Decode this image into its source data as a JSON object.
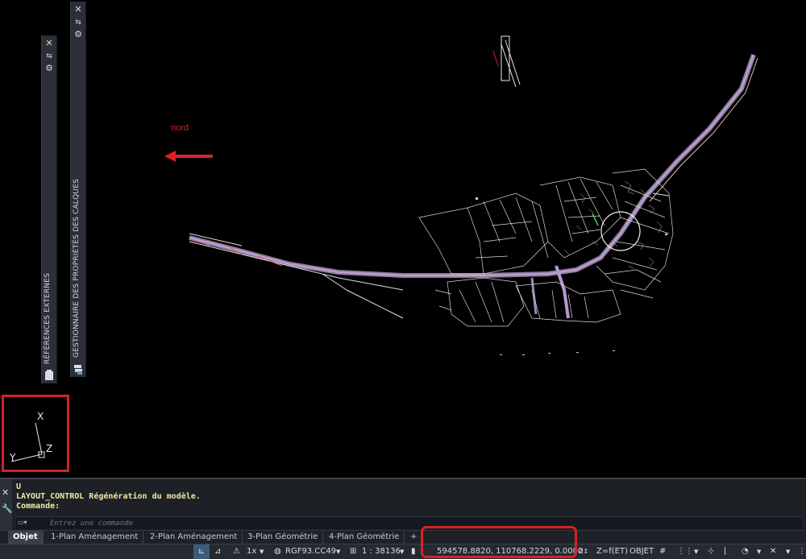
{
  "canvas": {
    "annotation_nord": "nord"
  },
  "palettes": {
    "external_refs": {
      "title": "RÉFÉRENCES EXTERNES"
    },
    "layer_props": {
      "title": "GESTIONNAIRE DES PROPRIÉTÉS DES CALQUES"
    }
  },
  "ucs": {
    "x": "X",
    "y": "Y",
    "z": "Z"
  },
  "command": {
    "lines": [
      "U",
      "LAYOUT_CONTROL Régénération du modèle.",
      "Commande:"
    ],
    "placeholder": "Entrez une commande"
  },
  "tabs": [
    {
      "label": "Objet",
      "active": true
    },
    {
      "label": "1-Plan Aménagement"
    },
    {
      "label": "2-Plan Aménagement"
    },
    {
      "label": "3-Plan Géométrie"
    },
    {
      "label": "4-Plan Géométrie"
    },
    {
      "label": "+"
    }
  ],
  "status": {
    "scale_factor": "1x",
    "coord_system": "RGF93.CC49",
    "annotation_scale": "1 : 38136",
    "coordinates": "594578.8820, 110768.2229, 0.0000",
    "z_mode": "Z=f(ET)",
    "object_mode": "OBJET"
  },
  "colors": {
    "accent_red": "#d0242a",
    "canvas_bg": "#000000",
    "cmd_text": "#f1e9a5"
  }
}
